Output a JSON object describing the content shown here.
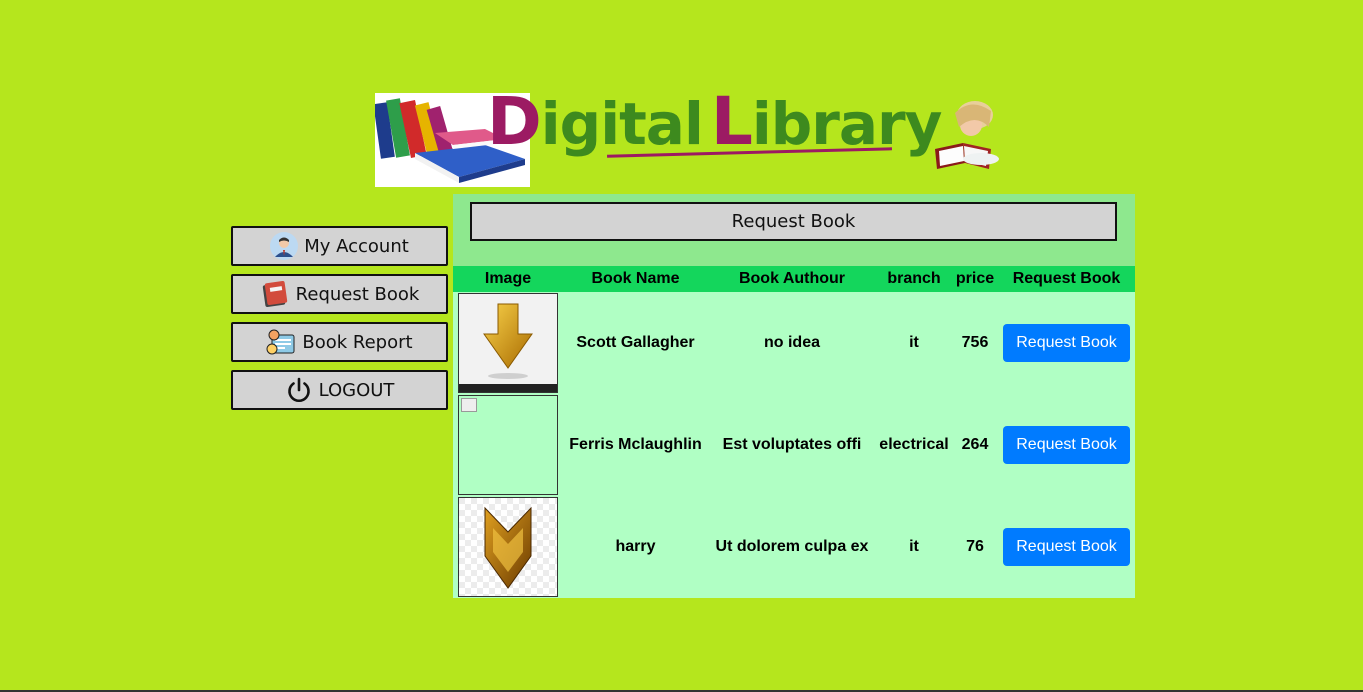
{
  "logo": {
    "text_part1": "D",
    "text_part2": "igital",
    "text_part3": "L",
    "text_part4": "ibrary"
  },
  "sidebar": {
    "items": [
      {
        "label": "My Account",
        "icon": "user-avatar-icon"
      },
      {
        "label": "Request Book",
        "icon": "book-icon"
      },
      {
        "label": "Book Report",
        "icon": "report-icon"
      },
      {
        "label": "LOGOUT",
        "icon": "power-icon"
      }
    ]
  },
  "panel": {
    "title": "Request Book"
  },
  "table": {
    "headers": [
      "Image",
      "Book Name",
      "Book Authour",
      "branch",
      "price",
      "Request Book"
    ],
    "rows": [
      {
        "image": "gold-down-arrow-image",
        "name": "Scott Gallagher",
        "author": "no idea",
        "branch": "it",
        "price": "756",
        "action": "Request Book"
      },
      {
        "image": "broken-image",
        "name": "Ferris Mclaughlin",
        "author": "Est voluptates offi",
        "branch": "electrical",
        "price": "264",
        "action": "Request Book"
      },
      {
        "image": "gold-chevron-image",
        "name": "harry",
        "author": "Ut dolorem culpa ex",
        "branch": "it",
        "price": "76",
        "action": "Request Book"
      }
    ]
  },
  "colors": {
    "background": "#b5e61d",
    "panel": "#b0ffc4",
    "panel_header": "#8ee88e",
    "table_header": "#14d65c",
    "button": "#007bff",
    "logo_magenta": "#9c1b63",
    "logo_green": "#3d8a1e"
  }
}
